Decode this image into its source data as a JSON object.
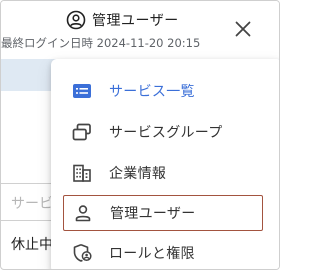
{
  "header": {
    "user_icon": "account-circle-icon",
    "user_name": "管理ユーザー",
    "last_login": "最終ログイン日時 2024-11-20 20:15",
    "close_icon": "close-icon"
  },
  "underlay": {
    "input_placeholder": "サービ",
    "row_text": "休止中"
  },
  "menu": {
    "items": [
      {
        "label": "サービス一覧",
        "icon": "list-icon",
        "state": "active"
      },
      {
        "label": "サービスグループ",
        "icon": "stacked-windows-icon",
        "state": "normal"
      },
      {
        "label": "企業情報",
        "icon": "building-icon",
        "state": "normal"
      },
      {
        "label": "管理ユーザー",
        "icon": "person-icon",
        "state": "hover"
      },
      {
        "label": "ロールと権限",
        "icon": "shield-user-icon",
        "state": "normal"
      }
    ]
  },
  "colors": {
    "accent": "#3b6fd8",
    "hover_border": "#a3533f",
    "band": "#dfe9f3"
  }
}
